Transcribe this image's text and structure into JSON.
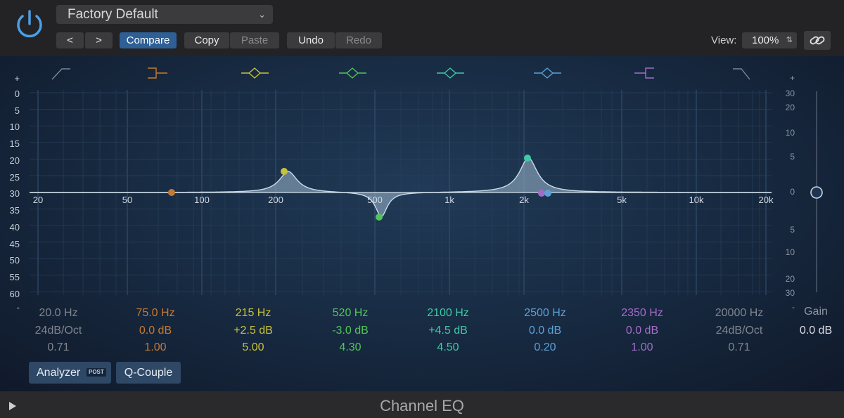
{
  "header": {
    "preset": "Factory Default",
    "nav_back": "<",
    "nav_forward": ">",
    "compare": "Compare",
    "copy": "Copy",
    "paste": "Paste",
    "undo": "Undo",
    "redo": "Redo",
    "view_label": "View:",
    "view_value": "100%"
  },
  "colors": {
    "accent_blue": "#2e5f95",
    "power": "#4ba0e6",
    "band_colors": [
      "#7f8590",
      "#c77a2f",
      "#c8c23a",
      "#52c45a",
      "#3fc9a7",
      "#5aa2d8",
      "#a46cc9",
      "#7f8590"
    ]
  },
  "graph": {
    "db_scale_left": [
      "+",
      "0",
      "5",
      "10",
      "15",
      "20",
      "25",
      "30",
      "35",
      "40",
      "45",
      "50",
      "55",
      "60",
      "-"
    ],
    "db_scale_right": [
      "+",
      "30",
      "20",
      "10",
      "5",
      "0",
      "5",
      "10",
      "20",
      "30",
      "-"
    ],
    "freq_labels": [
      "20",
      "50",
      "100",
      "200",
      "500",
      "1k",
      "2k",
      "5k",
      "10k",
      "20k"
    ]
  },
  "bands": [
    {
      "freq": "20.0 Hz",
      "gain": "24dB/Oct",
      "q": "0.71",
      "icon": "low-cut-icon"
    },
    {
      "freq": "75.0 Hz",
      "gain": "0.0 dB",
      "q": "1.00",
      "icon": "low-shelf-icon"
    },
    {
      "freq": "215 Hz",
      "gain": "+2.5 dB",
      "q": "5.00",
      "icon": "bell-icon"
    },
    {
      "freq": "520 Hz",
      "gain": "-3.0 dB",
      "q": "4.30",
      "icon": "bell-icon"
    },
    {
      "freq": "2100 Hz",
      "gain": "+4.5 dB",
      "q": "4.50",
      "icon": "bell-icon"
    },
    {
      "freq": "2500 Hz",
      "gain": "0.0 dB",
      "q": "0.20",
      "icon": "bell-icon"
    },
    {
      "freq": "2350 Hz",
      "gain": "0.0 dB",
      "q": "1.00",
      "icon": "high-shelf-icon"
    },
    {
      "freq": "20000 Hz",
      "gain": "24dB/Oct",
      "q": "0.71",
      "icon": "high-cut-icon"
    }
  ],
  "output": {
    "gain_label": "Gain",
    "gain_value": "0.0 dB"
  },
  "buttons": {
    "analyzer": "Analyzer",
    "analyzer_badge": "POST",
    "q_couple": "Q-Couple"
  },
  "footer": {
    "title": "Channel EQ"
  }
}
